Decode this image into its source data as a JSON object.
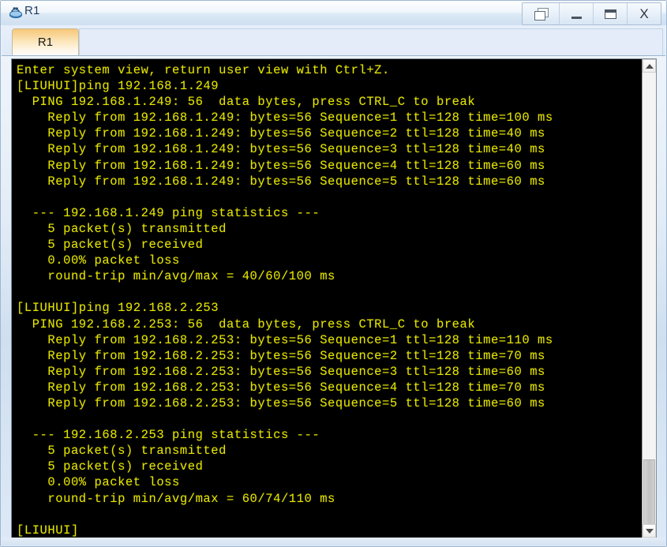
{
  "window": {
    "title": "R1",
    "app_icon": "router-icon",
    "controls": [
      {
        "name": "restore-button",
        "icon": "restore-window-icon",
        "label": ""
      },
      {
        "name": "minimize-button",
        "icon": "minimize-icon",
        "label": ""
      },
      {
        "name": "maximize-button",
        "icon": "maximize-icon",
        "label": ""
      },
      {
        "name": "close-button",
        "icon": "close-icon",
        "label": "X"
      }
    ]
  },
  "tabs": [
    {
      "label": "R1",
      "active": true
    }
  ],
  "terminal": {
    "background_color": "#000000",
    "text_color": "#e3e300",
    "lines": [
      "Enter system view, return user view with Ctrl+Z.",
      "[LIUHUI]ping 192.168.1.249",
      "  PING 192.168.1.249: 56  data bytes, press CTRL_C to break",
      "    Reply from 192.168.1.249: bytes=56 Sequence=1 ttl=128 time=100 ms",
      "    Reply from 192.168.1.249: bytes=56 Sequence=2 ttl=128 time=40 ms",
      "    Reply from 192.168.1.249: bytes=56 Sequence=3 ttl=128 time=40 ms",
      "    Reply from 192.168.1.249: bytes=56 Sequence=4 ttl=128 time=60 ms",
      "    Reply from 192.168.1.249: bytes=56 Sequence=5 ttl=128 time=60 ms",
      "",
      "  --- 192.168.1.249 ping statistics ---",
      "    5 packet(s) transmitted",
      "    5 packet(s) received",
      "    0.00% packet loss",
      "    round-trip min/avg/max = 40/60/100 ms",
      "",
      "[LIUHUI]ping 192.168.2.253",
      "  PING 192.168.2.253: 56  data bytes, press CTRL_C to break",
      "    Reply from 192.168.2.253: bytes=56 Sequence=1 ttl=128 time=110 ms",
      "    Reply from 192.168.2.253: bytes=56 Sequence=2 ttl=128 time=70 ms",
      "    Reply from 192.168.2.253: bytes=56 Sequence=3 ttl=128 time=60 ms",
      "    Reply from 192.168.2.253: bytes=56 Sequence=4 ttl=128 time=70 ms",
      "    Reply from 192.168.2.253: bytes=56 Sequence=5 ttl=128 time=60 ms",
      "",
      "  --- 192.168.2.253 ping statistics ---",
      "    5 packet(s) transmitted",
      "    5 packet(s) received",
      "    0.00% packet loss",
      "    round-trip min/avg/max = 60/74/110 ms",
      "",
      "[LIUHUI]"
    ],
    "text": "Enter system view, return user view with Ctrl+Z.\n[LIUHUI]ping 192.168.1.249\n  PING 192.168.1.249: 56  data bytes, press CTRL_C to break\n    Reply from 192.168.1.249: bytes=56 Sequence=1 ttl=128 time=100 ms\n    Reply from 192.168.1.249: bytes=56 Sequence=2 ttl=128 time=40 ms\n    Reply from 192.168.1.249: bytes=56 Sequence=3 ttl=128 time=40 ms\n    Reply from 192.168.1.249: bytes=56 Sequence=4 ttl=128 time=60 ms\n    Reply from 192.168.1.249: bytes=56 Sequence=5 ttl=128 time=60 ms\n\n  --- 192.168.1.249 ping statistics ---\n    5 packet(s) transmitted\n    5 packet(s) received\n    0.00% packet loss\n    round-trip min/avg/max = 40/60/100 ms\n\n[LIUHUI]ping 192.168.2.253\n  PING 192.168.2.253: 56  data bytes, press CTRL_C to break\n    Reply from 192.168.2.253: bytes=56 Sequence=1 ttl=128 time=110 ms\n    Reply from 192.168.2.253: bytes=56 Sequence=2 ttl=128 time=70 ms\n    Reply from 192.168.2.253: bytes=56 Sequence=3 ttl=128 time=60 ms\n    Reply from 192.168.2.253: bytes=56 Sequence=4 ttl=128 time=70 ms\n    Reply from 192.168.2.253: bytes=56 Sequence=5 ttl=128 time=60 ms\n\n  --- 192.168.2.253 ping statistics ---\n    5 packet(s) transmitted\n    5 packet(s) received\n    0.00% packet loss\n    round-trip min/avg/max = 60/74/110 ms\n\n[LIUHUI]"
  },
  "scrollbar": {
    "up_arrow": "chevron-up-icon",
    "down_arrow": "chevron-down-icon",
    "thumb_position_pct": 85
  }
}
